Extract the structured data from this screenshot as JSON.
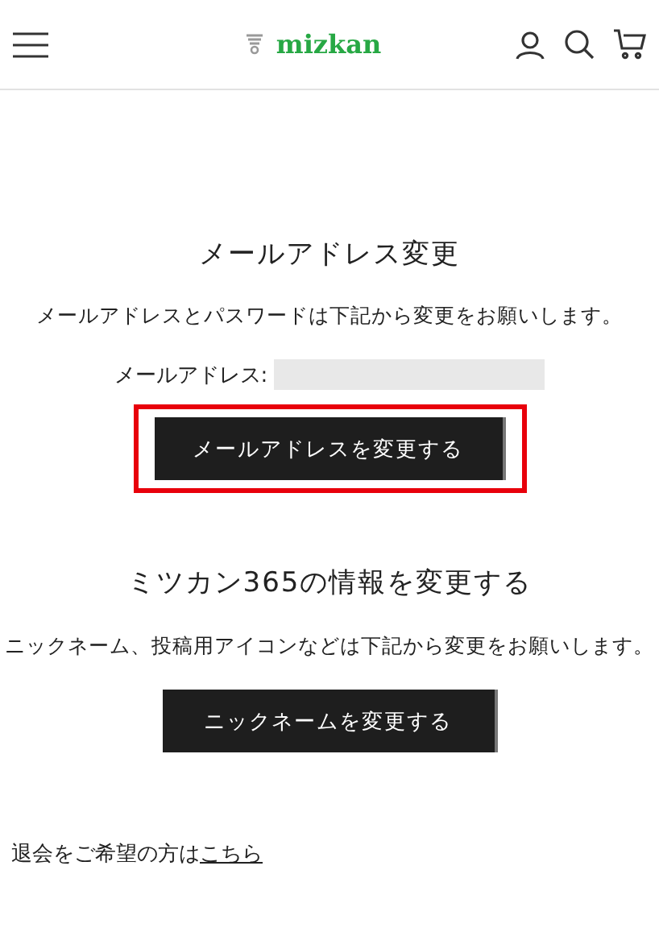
{
  "header": {
    "logo": "mizkan"
  },
  "email_section": {
    "title": "メールアドレス変更",
    "description": "メールアドレスとパスワードは下記から変更をお願いします。",
    "email_label": "メールアドレス:",
    "button": {
      "label": "メールアドレスを変更する",
      "highlighted": true
    }
  },
  "profile_section": {
    "title": "ミツカン365の情報を変更する",
    "description": "ニックネーム、投稿用アイコンなどは下記から変更をお願いします。",
    "button": {
      "label": "ニックネームを変更する",
      "highlighted": false
    }
  },
  "withdraw": {
    "text": "退会をご希望の方は",
    "link": "こちら"
  }
}
